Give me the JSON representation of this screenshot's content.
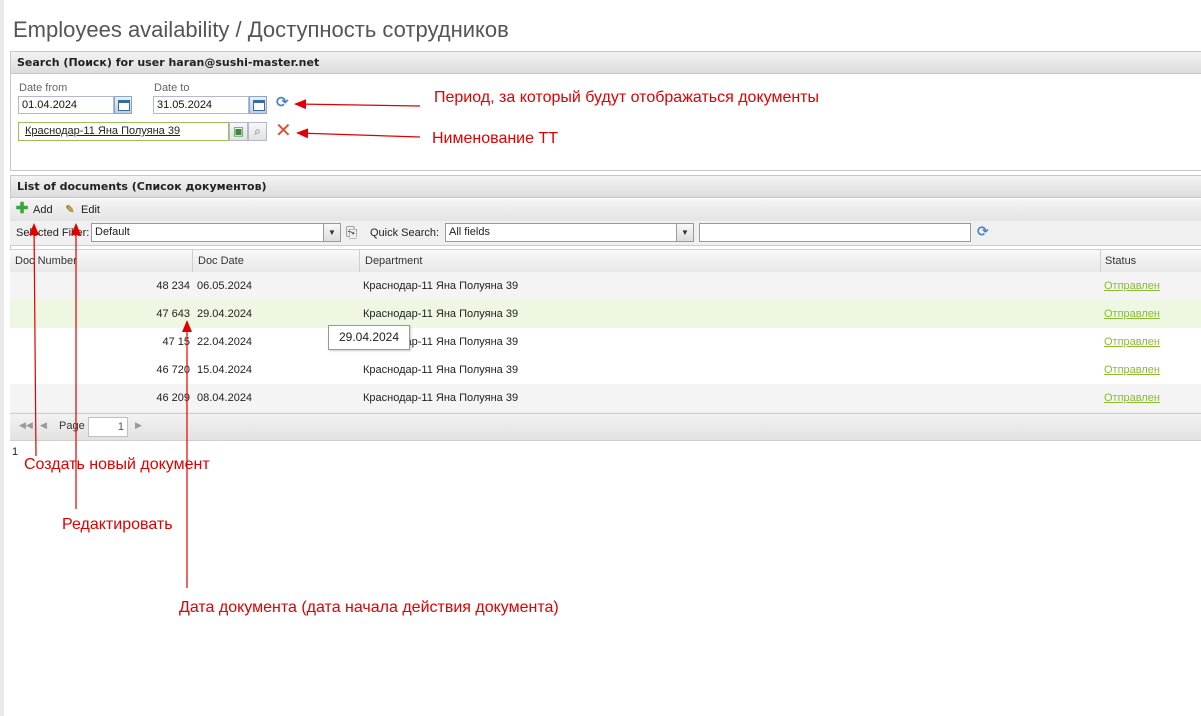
{
  "page_title": "Employees availability / Доступность сотрудников",
  "search_panel": {
    "header": "Search (Поиск) for user haran@sushi-master.net",
    "date_from_label": "Date from",
    "date_from_value": "01.04.2024",
    "date_to_label": "Date to",
    "date_to_value": "31.05.2024",
    "store_value": "Краснодар-11 Яна Полуяна 39"
  },
  "documents_panel": {
    "header": "List of documents (Список документов)",
    "add_label": "Add",
    "edit_label": "Edit",
    "selected_filter_label": "Selected Filter:",
    "filter_value": "Default",
    "quick_search_label": "Quick Search:",
    "quick_search_field": "All fields",
    "quick_search_text": ""
  },
  "grid": {
    "columns": [
      "Doc Number",
      "Doc Date",
      "Department",
      "Status"
    ],
    "rows": [
      {
        "number": "48 234",
        "date": "06.05.2024",
        "department": "Краснодар-11 Яна Полуяна 39",
        "status": "Отправлен"
      },
      {
        "number": "47 643",
        "date": "29.04.2024",
        "department": "Краснодар-11 Яна Полуяна 39",
        "status": "Отправлен"
      },
      {
        "number": "47 15",
        "date": "22.04.2024",
        "department": "Краснодар-11 Яна Полуяна 39",
        "status": "Отправлен"
      },
      {
        "number": "46 720",
        "date": "15.04.2024",
        "department": "Краснодар-11 Яна Полуяна 39",
        "status": "Отправлен"
      },
      {
        "number": "46 209",
        "date": "08.04.2024",
        "department": "Краснодар-11 Яна Полуяна 39",
        "status": "Отправлен"
      }
    ]
  },
  "pager": {
    "page_label": "Page",
    "page_value": "1",
    "total": "1"
  },
  "tooltip": "29.04.2024",
  "annotations": {
    "period": "Период, за который будут отображаться документы",
    "store_name": "Нименование ТТ",
    "create": "Создать новый документ",
    "edit": "Редактировать",
    "doc_date": "Дата документа (дата начала действия документа)"
  },
  "colors": {
    "annotation": "#e00000",
    "status_link": "#8bbb2e",
    "row_highlight": "#eef7e2",
    "row_alt": "#f4f4f4"
  }
}
